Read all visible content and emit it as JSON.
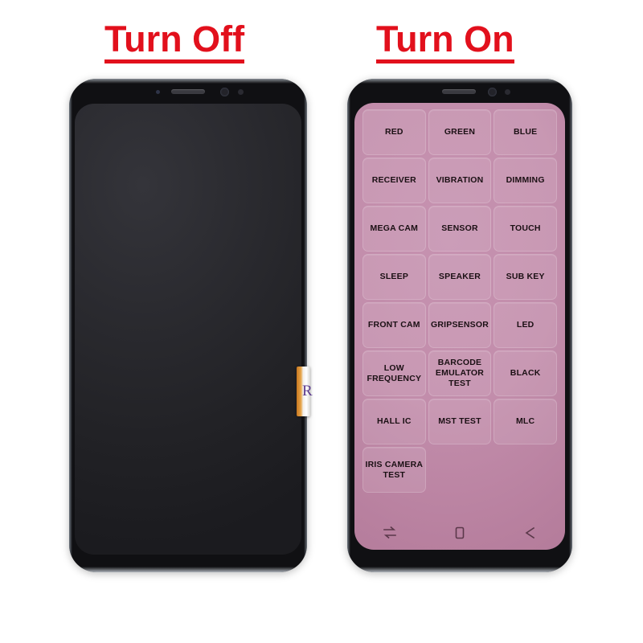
{
  "titles": {
    "left": "Turn Off",
    "right": "Turn On"
  },
  "colors": {
    "title_red": "#e2101c",
    "screen_on_pink": "#c28dab",
    "screen_off_black": "#222226",
    "tile_text": "#1b1014",
    "nav_icon": "#4a2b3b",
    "flex_orange": "#e6a548"
  },
  "phone_off": {
    "label": "phone-screen-off",
    "hardware": {
      "earpiece": "earpiece-speaker",
      "front_camera": "front-camera",
      "sensor": "proximity-sensor",
      "iris": "iris-scanner"
    },
    "flex_cable": {
      "label": "display-flex-cable-connector",
      "mark": "R"
    }
  },
  "phone_on": {
    "label": "phone-screen-on",
    "hardware": {
      "earpiece": "earpiece-speaker",
      "front_camera": "front-camera",
      "sensor": "proximity-sensor"
    },
    "test_menu": {
      "tiles": [
        {
          "label": "RED",
          "name": "test-red"
        },
        {
          "label": "GREEN",
          "name": "test-green"
        },
        {
          "label": "BLUE",
          "name": "test-blue"
        },
        {
          "label": "RECEIVER",
          "name": "test-receiver"
        },
        {
          "label": "VIBRATION",
          "name": "test-vibration"
        },
        {
          "label": "DIMMING",
          "name": "test-dimming"
        },
        {
          "label": "MEGA CAM",
          "name": "test-mega-cam"
        },
        {
          "label": "SENSOR",
          "name": "test-sensor"
        },
        {
          "label": "TOUCH",
          "name": "test-touch"
        },
        {
          "label": "SLEEP",
          "name": "test-sleep"
        },
        {
          "label": "SPEAKER",
          "name": "test-speaker"
        },
        {
          "label": "SUB KEY",
          "name": "test-sub-key"
        },
        {
          "label": "FRONT CAM",
          "name": "test-front-cam"
        },
        {
          "label": "GRIPSENSOR",
          "name": "test-gripsensor"
        },
        {
          "label": "LED",
          "name": "test-led"
        },
        {
          "label": "LOW FREQUENCY",
          "name": "test-low-frequency"
        },
        {
          "label": "BARCODE\nEMULATOR TEST",
          "name": "test-barcode-emulator"
        },
        {
          "label": "BLACK",
          "name": "test-black"
        },
        {
          "label": "HALL IC",
          "name": "test-hall-ic"
        },
        {
          "label": "MST TEST",
          "name": "test-mst"
        },
        {
          "label": "MLC",
          "name": "test-mlc"
        },
        {
          "label": "IRIS CAMERA\nTEST",
          "name": "test-iris-camera"
        }
      ]
    },
    "nav_bar": {
      "recents": "recents-icon",
      "home": "home-icon",
      "back": "back-icon"
    }
  }
}
